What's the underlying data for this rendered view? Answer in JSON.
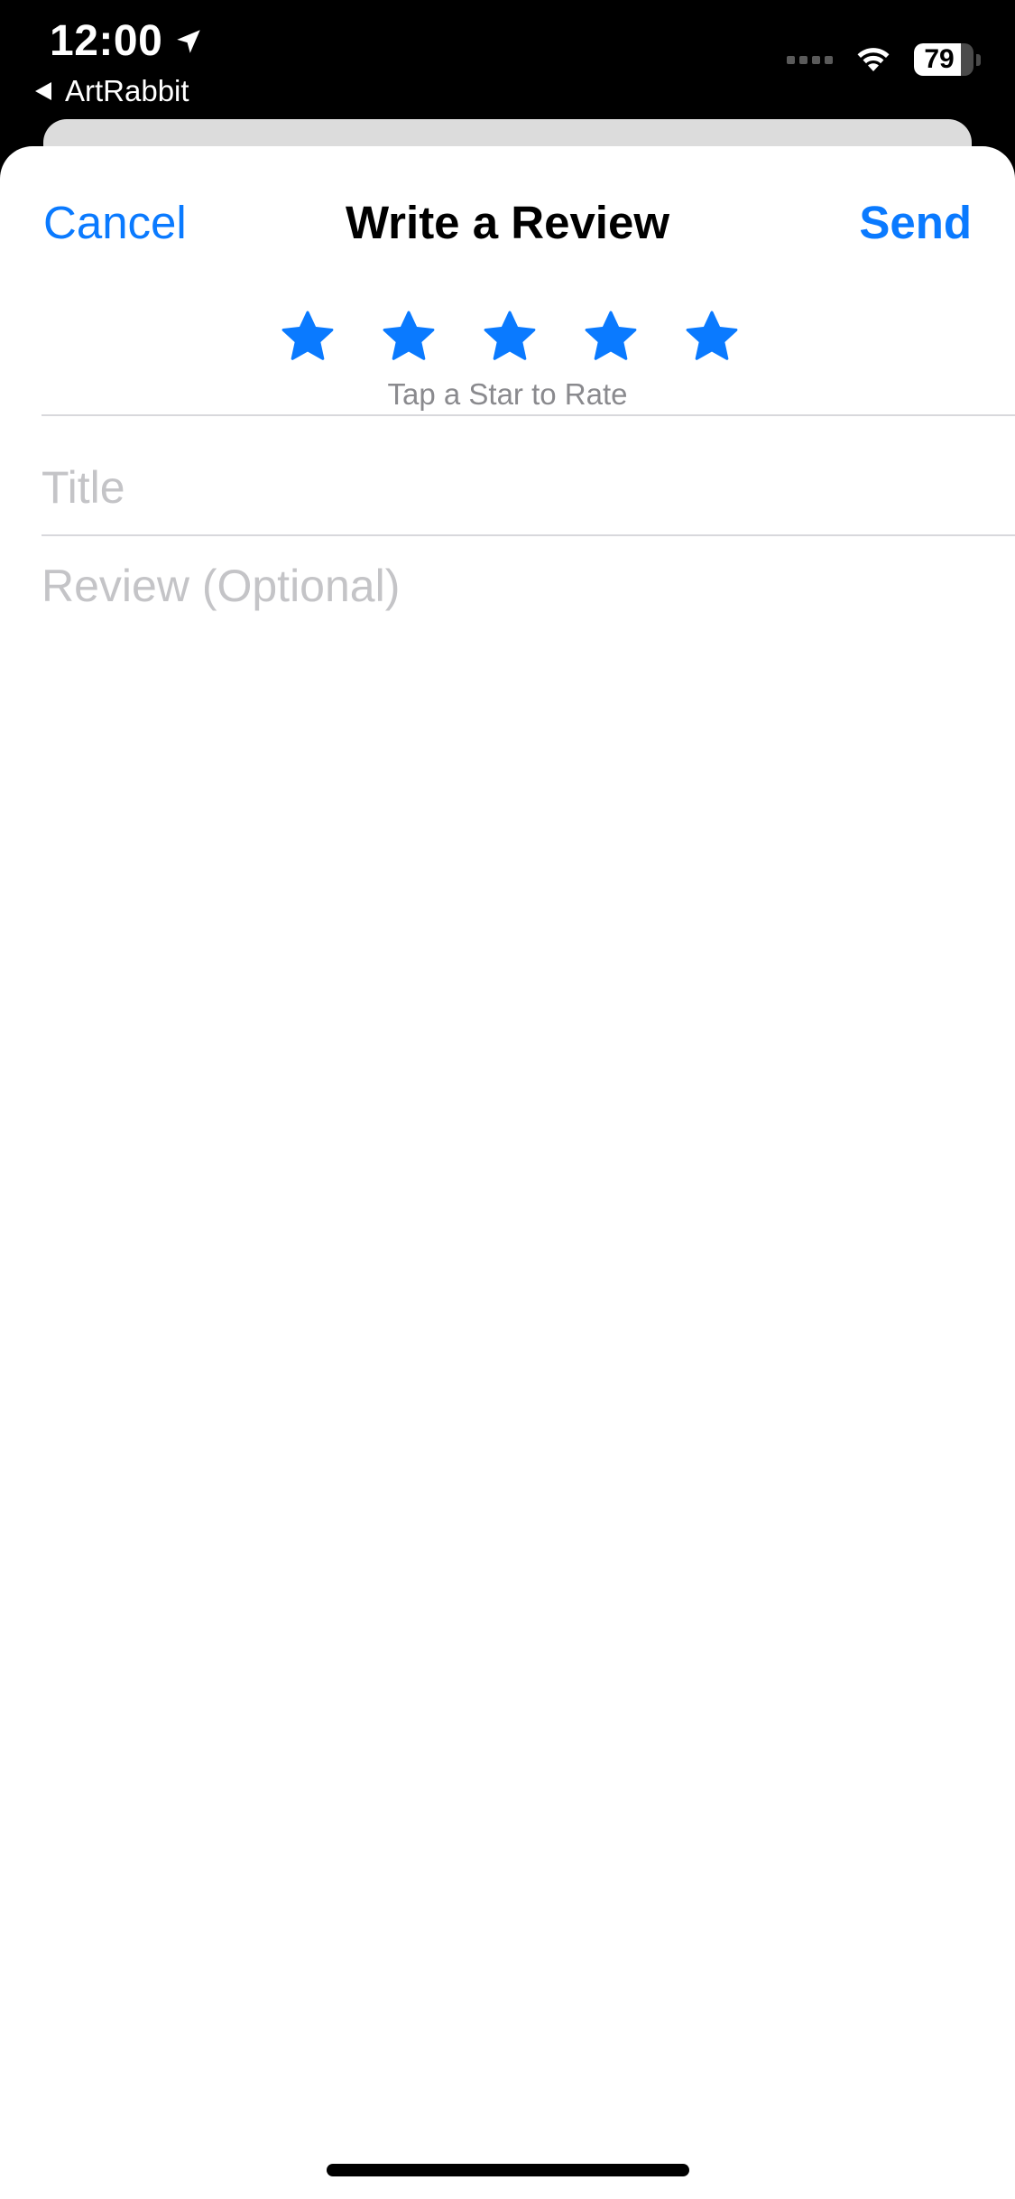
{
  "status_bar": {
    "time": "12:00",
    "back_app": "ArtRabbit",
    "battery_level": "79",
    "battery_fraction": 0.79,
    "icons": {
      "location": "location-arrow-icon",
      "back": "back-triangle-icon",
      "signal": "cellular-signal-icon",
      "wifi": "wifi-icon",
      "battery": "battery-icon"
    }
  },
  "nav": {
    "cancel_label": "Cancel",
    "title": "Write a Review",
    "send_label": "Send"
  },
  "rating": {
    "max_stars": 5,
    "hint": "Tap a Star to Rate",
    "star_icon": "star-icon"
  },
  "form": {
    "title_placeholder": "Title",
    "title_value": "",
    "review_placeholder": "Review (Optional)",
    "review_value": ""
  },
  "colors": {
    "accent": "#0a7aff",
    "status_bar_bg": "#000000",
    "sheet_bg": "#ffffff",
    "placeholder": "#c4c4c7",
    "hint_text": "#8a8a8e",
    "divider": "#d8d8dc"
  }
}
